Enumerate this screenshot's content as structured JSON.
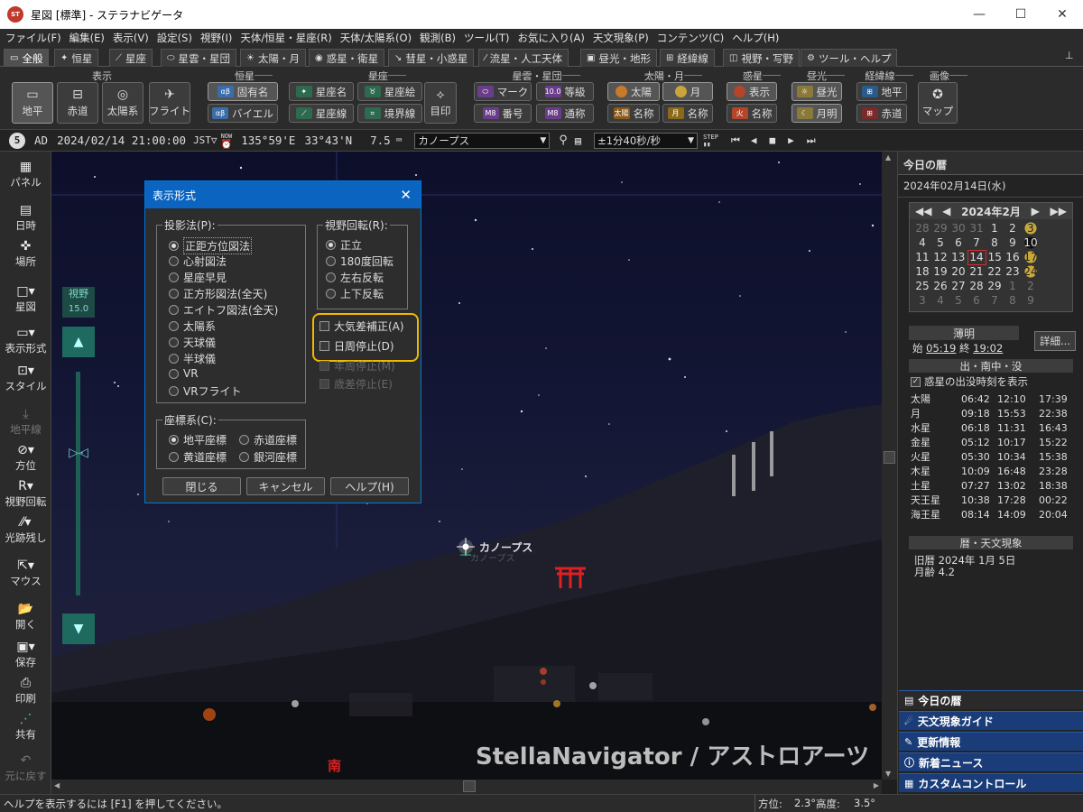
{
  "window": {
    "title": "星図 [標準] - ステラナビゲータ",
    "icon_label": "ST"
  },
  "menu": [
    "ファイル(F)",
    "編集(E)",
    "表示(V)",
    "設定(S)",
    "視野(I)",
    "天体/恒星・星座(R)",
    "天体/太陽系(O)",
    "観測(B)",
    "ツール(T)",
    "お気に入り(A)",
    "天文現象(P)",
    "コンテンツ(C)",
    "ヘルプ(H)"
  ],
  "tabs": [
    "全般",
    "恒星",
    "星座",
    "星雲・星団",
    "太陽・月",
    "惑星・衛星",
    "彗星・小惑星",
    "流星・人工天体",
    "昼光・地形",
    "経緯線",
    "視野・写野",
    "ツール・ヘルプ"
  ],
  "ribbon": {
    "groups": [
      "表示",
      "恒星",
      "星座",
      "星雲・星団",
      "太陽・月",
      "惑星",
      "昼光",
      "経緯線",
      "画像"
    ],
    "display_buttons": [
      "地平",
      "赤道",
      "太陽系",
      "フライト"
    ],
    "star_buttons": [
      "固有名",
      "バイエル"
    ],
    "constellation_buttons": [
      "星座名",
      "星座絵",
      "星座線",
      "境界線",
      "目印"
    ],
    "nebula_buttons": [
      "マーク",
      "等級",
      "番号",
      "通称"
    ],
    "sunmoon_buttons": [
      "太陽",
      "月",
      "名称",
      "名称"
    ],
    "planet_buttons": [
      "表示",
      "名称"
    ],
    "daylight_buttons": [
      "昼光",
      "月明"
    ],
    "grid_buttons": [
      "地平",
      "赤道"
    ],
    "image_buttons": [
      "マップ"
    ]
  },
  "status": {
    "badge": "5",
    "era": "AD",
    "datetime": "2024/02/14 21:00:00",
    "tz": "JST▽",
    "now_label": "NOW",
    "longitude": "135°59'E",
    "latitude": "33°43'N",
    "magnitude": "7.5",
    "target": "カノープス",
    "step": "±1分40秒/秒",
    "step_label": "STEP"
  },
  "leftbar": [
    "パネル",
    "日時",
    "場所",
    "星図",
    "表示形式",
    "スタイル",
    "地平線",
    "方位",
    "視野回転",
    "光跡残し",
    "マウス",
    "開く",
    "保存",
    "印刷",
    "共有",
    "元に戻す"
  ],
  "sky": {
    "fov_label": "視野",
    "fov_value": "15.0",
    "star_label": "カノープス",
    "star_label2": "カノープス",
    "direction": "南",
    "watermark": "StellaNavigator / アストロアーツ"
  },
  "dialog": {
    "title": "表示形式",
    "projection_label": "投影法(P):",
    "projections": [
      "正距方位図法",
      "心射図法",
      "星座早見",
      "正方形図法(全天)",
      "エイトフ図法(全天)",
      "太陽系",
      "天球儀",
      "半球儀",
      "VR",
      "VRフライト"
    ],
    "projection_selected": "正距方位図法",
    "rotation_label": "視野回転(R):",
    "rotations": [
      "正立",
      "180度回転",
      "左右反転",
      "上下反転"
    ],
    "rotation_selected": "正立",
    "checks": [
      "大気差補正(A)",
      "日周停止(D)"
    ],
    "disabled_checks": [
      "年周停止(M)",
      "歳差停止(E)"
    ],
    "coord_label": "座標系(C):",
    "coords": [
      "地平座標",
      "赤道座標",
      "黄道座標",
      "銀河座標"
    ],
    "coord_selected": "地平座標",
    "buttons": [
      "閉じる",
      "キャンセル",
      "ヘルプ(H)"
    ]
  },
  "panel": {
    "title": "今日の暦",
    "date": "2024年02月14日(水)",
    "month": "2024年2月",
    "calendar": [
      [
        "28",
        "29",
        "30",
        "31",
        "1",
        "2",
        "3"
      ],
      [
        "4",
        "5",
        "6",
        "7",
        "8",
        "9",
        "10"
      ],
      [
        "11",
        "12",
        "13",
        "14",
        "15",
        "16",
        "17"
      ],
      [
        "18",
        "19",
        "20",
        "21",
        "22",
        "23",
        "24"
      ],
      [
        "25",
        "26",
        "27",
        "28",
        "29",
        "1",
        "2"
      ],
      [
        "3",
        "4",
        "5",
        "6",
        "7",
        "8",
        "9"
      ]
    ],
    "today": "14",
    "twilight_label": "薄明",
    "twilight_start_label": "始",
    "twilight_start": "05:19",
    "twilight_end_label": "終",
    "twilight_end": "19:02",
    "detail_button": "詳細...",
    "rise_label": "出・南中・没",
    "rise_check": "惑星の出没時刻を表示",
    "bodies": [
      {
        "name": "太陽",
        "rise": "06:42",
        "transit": "12:10",
        "set": "17:39"
      },
      {
        "name": "月",
        "rise": "09:18",
        "transit": "15:53",
        "set": "22:38"
      },
      {
        "name": "水星",
        "rise": "06:18",
        "transit": "11:31",
        "set": "16:43"
      },
      {
        "name": "金星",
        "rise": "05:12",
        "transit": "10:17",
        "set": "15:22"
      },
      {
        "name": "火星",
        "rise": "05:30",
        "transit": "10:34",
        "set": "15:38"
      },
      {
        "name": "木星",
        "rise": "10:09",
        "transit": "16:48",
        "set": "23:28"
      },
      {
        "name": "土星",
        "rise": "07:27",
        "transit": "13:02",
        "set": "18:38"
      },
      {
        "name": "天王星",
        "rise": "10:38",
        "transit": "17:28",
        "set": "00:22"
      },
      {
        "name": "海王星",
        "rise": "08:14",
        "transit": "14:09",
        "set": "20:04"
      }
    ],
    "events_label": "暦・天文現象",
    "lunar_date": "旧暦  2024年  1月  5日",
    "moon_age": "月齢  4.2",
    "nav": [
      "今日の暦",
      "天文現象ガイド",
      "更新情報",
      "新着ニュース",
      "カスタムコントロール"
    ]
  },
  "footer": {
    "help": "ヘルプを表示するには [F1] を押してください。",
    "azimuth_label": "方位:",
    "azimuth": "2.3°",
    "altitude_label": "高度:",
    "altitude": "3.5°"
  }
}
